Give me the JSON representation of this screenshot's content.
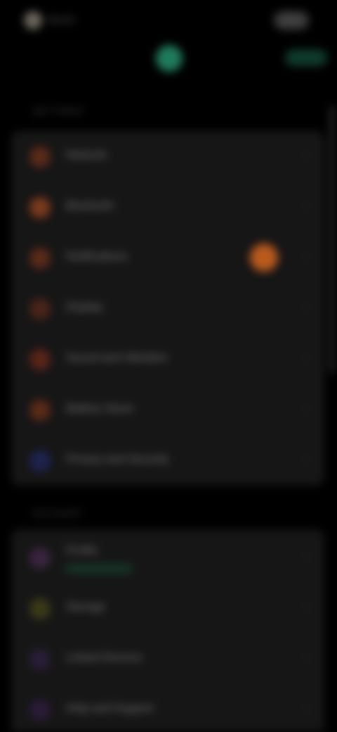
{
  "header": {
    "app_name": "Mesh",
    "action_label": "Edit"
  },
  "section1": {
    "title": "Settings",
    "items": [
      {
        "label": "Network",
        "icon": "network-icon",
        "color": "#5a2a18"
      },
      {
        "label": "Bluetooth",
        "icon": "bluetooth-icon",
        "color": "#7a3a1c"
      },
      {
        "label": "Notifications",
        "icon": "bell-icon",
        "color": "#5a2a18",
        "badge": true
      },
      {
        "label": "Display",
        "icon": "display-icon",
        "color": "#4a2418"
      },
      {
        "label": "Sound and Vibration",
        "icon": "sound-icon",
        "color": "#5a2418"
      },
      {
        "label": "Battery Saver",
        "icon": "battery-icon",
        "color": "#5a2a18"
      },
      {
        "label": "Privacy and Security",
        "icon": "shield-icon",
        "color": "#1e2350"
      }
    ]
  },
  "section2": {
    "title": "Account",
    "items": [
      {
        "label": "Profile",
        "icon": "user-icon",
        "color": "#3a2440",
        "sub": true
      },
      {
        "label": "Storage",
        "icon": "storage-icon",
        "color": "#3a3a18"
      },
      {
        "label": "Linked Devices",
        "icon": "devices-icon",
        "color": "#2a1e38"
      },
      {
        "label": "Help and Support",
        "icon": "help-icon",
        "color": "#2a1a38"
      }
    ]
  }
}
